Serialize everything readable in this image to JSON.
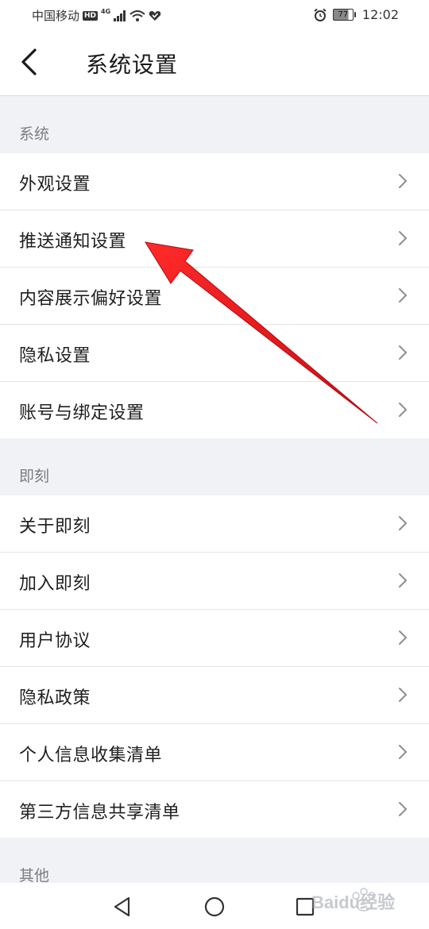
{
  "status_bar": {
    "carrier": "中国移动",
    "hd_badge": "HD",
    "network": "4G",
    "battery": "77",
    "time": "12:02"
  },
  "header": {
    "title": "系统设置",
    "back_icon": "chevron-left-icon"
  },
  "sections": [
    {
      "title": "系统",
      "items": [
        {
          "label": "外观设置"
        },
        {
          "label": "推送通知设置"
        },
        {
          "label": "内容展示偏好设置"
        },
        {
          "label": "隐私设置"
        },
        {
          "label": "账号与绑定设置"
        }
      ]
    },
    {
      "title": "即刻",
      "items": [
        {
          "label": "关于即刻"
        },
        {
          "label": "加入即刻"
        },
        {
          "label": "用户协议"
        },
        {
          "label": "隐私政策"
        },
        {
          "label": "个人信息收集清单"
        },
        {
          "label": "第三方信息共享清单"
        }
      ]
    },
    {
      "title": "其他",
      "items": []
    }
  ],
  "system_nav": {
    "back_icon": "triangle-back-icon",
    "home_icon": "circle-home-icon",
    "recents_icon": "square-recents-icon"
  },
  "annotation": {
    "arrow_color": "#e8141c"
  },
  "watermark": {
    "text": "Baidu经验"
  },
  "colors": {
    "section_bg": "#f0f2f5",
    "divider": "#e3e5e8",
    "section_text": "#7a7d82"
  }
}
